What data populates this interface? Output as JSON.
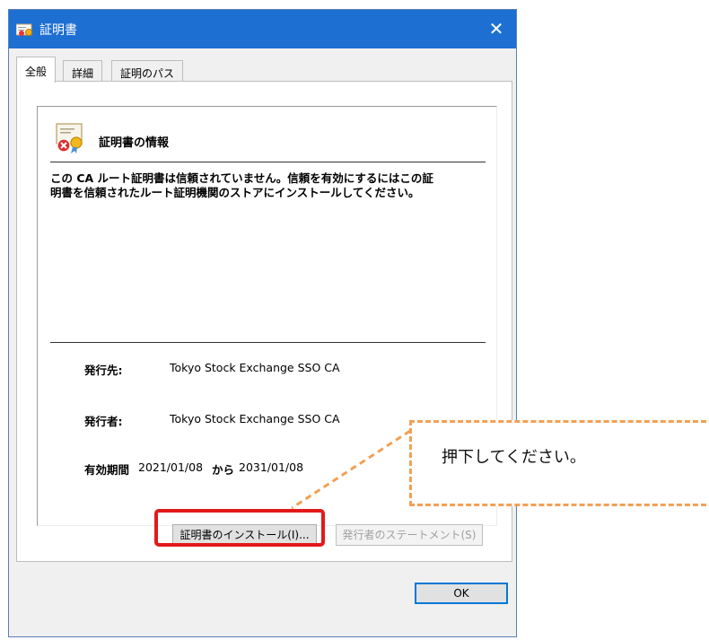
{
  "window": {
    "title": "証明書",
    "icon": "certificate-icon",
    "close_glyph": "✕"
  },
  "tabs": [
    {
      "label": "全般",
      "active": true
    },
    {
      "label": "詳細",
      "active": false
    },
    {
      "label": "証明のパス",
      "active": false
    }
  ],
  "info": {
    "icon": "certificate-error-icon",
    "title": "証明書の情報",
    "message_line1": "この CA ルート証明書は信頼されていません。信頼を有効にするにはこの証",
    "message_line2": "明書を信頼されたルート証明機関のストアにインストールしてください。"
  },
  "fields": {
    "issued_to_label": "発行先:",
    "issued_to_value": "Tokyo Stock Exchange SSO CA",
    "issued_by_label": "発行者:",
    "issued_by_value": "Tokyo Stock Exchange SSO CA",
    "validity_label": "有効期間",
    "valid_from": "2021/01/08",
    "from_word": "から",
    "valid_to": "2031/01/08"
  },
  "buttons": {
    "install": "証明書のインストール(I)...",
    "issuer_statement": "発行者のステートメント(S)",
    "ok": "OK"
  },
  "annotation": {
    "callout_text": "押下してください。",
    "highlight_color": "#e31919",
    "callout_color": "#f2a055"
  },
  "colors": {
    "titlebar": "#1e6fd2",
    "accent": "#0078d7"
  }
}
